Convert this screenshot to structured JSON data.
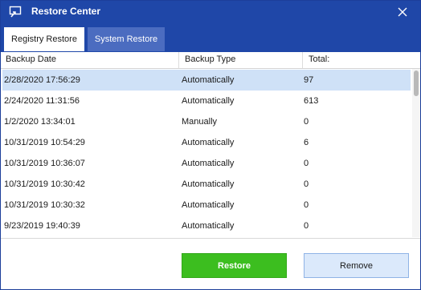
{
  "window": {
    "title": "Restore Center",
    "icon": "restore-monitor-icon",
    "close_icon": "close-icon"
  },
  "tabs": [
    {
      "label": "Registry Restore",
      "active": true
    },
    {
      "label": "System Restore",
      "active": false
    }
  ],
  "table": {
    "columns": [
      "Backup Date",
      "Backup Type",
      "Total:"
    ],
    "rows": [
      {
        "date": "2/28/2020 17:56:29",
        "type": "Automatically",
        "total": "97",
        "selected": true
      },
      {
        "date": "2/24/2020 11:31:56",
        "type": "Automatically",
        "total": "613",
        "selected": false
      },
      {
        "date": "1/2/2020 13:34:01",
        "type": "Manually",
        "total": "0",
        "selected": false
      },
      {
        "date": "10/31/2019 10:54:29",
        "type": "Automatically",
        "total": "6",
        "selected": false
      },
      {
        "date": "10/31/2019 10:36:07",
        "type": "Automatically",
        "total": "0",
        "selected": false
      },
      {
        "date": "10/31/2019 10:30:42",
        "type": "Automatically",
        "total": "0",
        "selected": false
      },
      {
        "date": "10/31/2019 10:30:32",
        "type": "Automatically",
        "total": "0",
        "selected": false
      },
      {
        "date": "9/23/2019 19:40:39",
        "type": "Automatically",
        "total": "0",
        "selected": false
      }
    ]
  },
  "buttons": {
    "restore_label": "Restore",
    "remove_label": "Remove"
  },
  "colors": {
    "titlebar": "#1f47a8",
    "selected_row": "#cfe1f7",
    "restore_button": "#3cbe1f",
    "remove_button": "#dbe9fb"
  }
}
